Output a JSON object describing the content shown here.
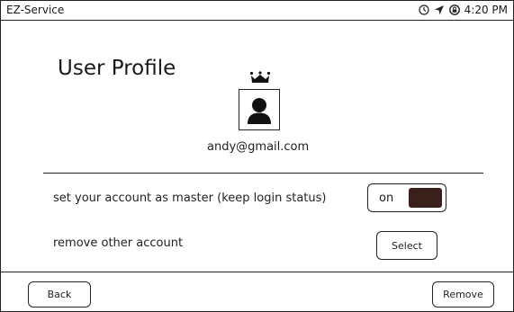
{
  "status_bar": {
    "app_name": "EZ-Service",
    "time": "4:20 PM",
    "icons": [
      "alarm-clock-icon",
      "location-arrow-icon",
      "rotation-lock-icon"
    ]
  },
  "profile": {
    "title": "User Profile",
    "email": "andy@gmail.com",
    "crown_icon": "crown-icon",
    "avatar_icon": "user-silhouette-icon"
  },
  "settings": {
    "master_label": "set your account as master (keep login status)",
    "master_toggle": {
      "state_label": "on",
      "value": true,
      "knob_color": "#3a1f1a"
    },
    "remove_label": "remove other account",
    "select_label": "Select"
  },
  "footer": {
    "back_label": "Back",
    "remove_label": "Remove"
  }
}
